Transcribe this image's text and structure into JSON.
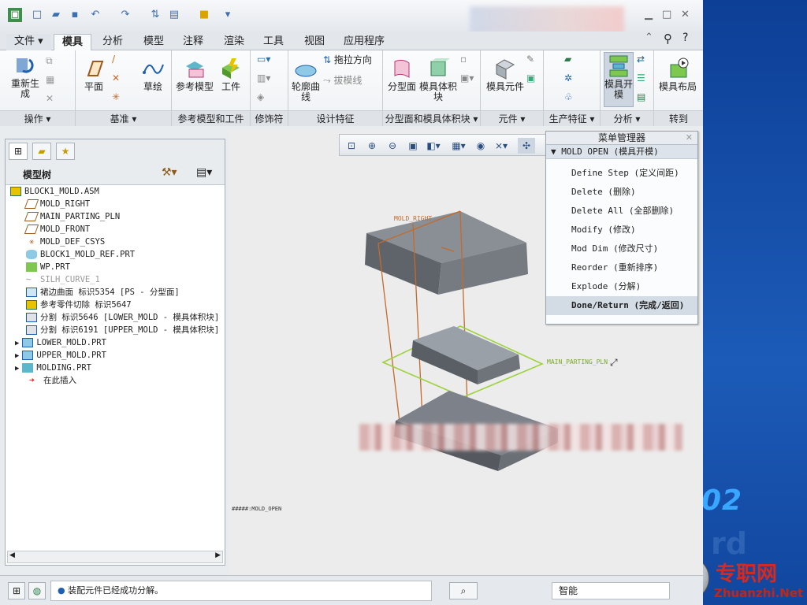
{
  "tabs": [
    "文件",
    "模具",
    "分析",
    "模型",
    "注释",
    "渲染",
    "工具",
    "视图",
    "应用程序"
  ],
  "active_tab": "模具",
  "ribbon": {
    "groups": [
      {
        "label": "操作",
        "items": [
          "重新生成"
        ]
      },
      {
        "label": "基准",
        "items": [
          "平面",
          "草绘"
        ]
      },
      {
        "label": "参考模型和工件",
        "items": [
          "参考模型",
          "工件"
        ]
      },
      {
        "label": "修饰符",
        "items": []
      },
      {
        "label": "设计特征",
        "items": [
          "轮廓曲线",
          "拖拉方向",
          "拔模线"
        ]
      },
      {
        "label": "分型面和模具体积块",
        "items": [
          "分型面",
          "模具体积块"
        ]
      },
      {
        "label": "元件",
        "items": [
          "模具元件"
        ]
      },
      {
        "label": "生产特征",
        "items": []
      },
      {
        "label": "分析",
        "items": [
          "模具开模"
        ]
      },
      {
        "label": "转到",
        "items": [
          "模具布局"
        ]
      }
    ]
  },
  "left_panel": {
    "title": "模型树",
    "tree": [
      {
        "text": "BLOCK1_MOLD.ASM",
        "icon": "assembly-icon"
      },
      {
        "text": "MOLD_RIGHT",
        "icon": "datum-plane-icon"
      },
      {
        "text": "MAIN_PARTING_PLN",
        "icon": "datum-plane-icon"
      },
      {
        "text": "MOLD_FRONT",
        "icon": "datum-plane-icon"
      },
      {
        "text": "MOLD_DEF_CSYS",
        "icon": "csys-icon"
      },
      {
        "text": "BLOCK1_MOLD_REF.PRT",
        "icon": "ref-part-icon"
      },
      {
        "text": "WP.PRT",
        "icon": "workpiece-icon"
      },
      {
        "text": "SILH_CURVE_1",
        "icon": "curve-icon"
      },
      {
        "text": "裙边曲面 标识5354 [PS - 分型面]",
        "icon": "surface-icon"
      },
      {
        "text": "参考零件切除 标识5647",
        "icon": "cut-icon"
      },
      {
        "text": "分割 标识5646 [LOWER_MOLD - 模具体积块]",
        "icon": "split-icon"
      },
      {
        "text": "分割 标识6191 [UPPER_MOLD - 模具体积块]",
        "icon": "split-icon"
      },
      {
        "text": "LOWER_MOLD.PRT",
        "icon": "part-icon"
      },
      {
        "text": "UPPER_MOLD.PRT",
        "icon": "part-icon"
      },
      {
        "text": "MOLDING.PRT",
        "icon": "molding-icon"
      },
      {
        "text": "在此插入",
        "icon": "insert-arrow-icon"
      }
    ]
  },
  "viewport": {
    "labels": [
      "MOLD_RIGHT",
      "MAIN_PARTING_PLN"
    ],
    "state_label": "#####:MOLD_OPEN"
  },
  "menu_manager": {
    "title": "菜单管理器",
    "section": "MOLD OPEN (模具开模)",
    "items": [
      "Define Step (定义间距)",
      "Delete (删除)",
      "Delete All (全部删除)",
      "Modify (修改)",
      "Mod Dim (修改尺寸)",
      "Reorder (重新排序)",
      "Explode (分解)",
      "Done/Return (完成/返回)"
    ]
  },
  "status": {
    "message": "装配元件已经成功分解。",
    "filter": "智能"
  },
  "desktop": {
    "number": "02",
    "brand_cn": "专职网",
    "brand_en": "Zhuanzhi.Net"
  },
  "colors": {
    "accent": "#3e6fae",
    "part_gray": "#6e737a",
    "parting_plane": "#9dd23a",
    "datum_orange": "#c46a2a",
    "brand_red": "#d52a1f"
  }
}
